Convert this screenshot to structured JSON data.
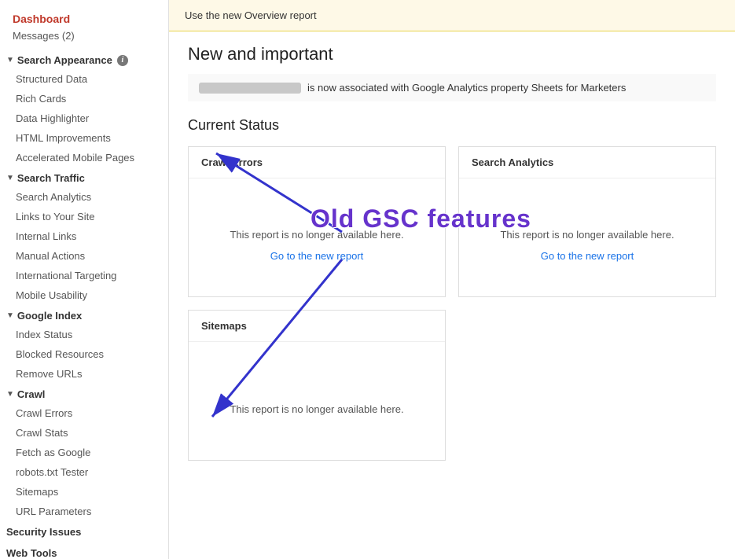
{
  "sidebar": {
    "dashboard_label": "Dashboard",
    "messages_label": "Messages (2)",
    "sections": [
      {
        "id": "search-appearance",
        "label": "Search Appearance",
        "has_info": true,
        "items": [
          "Structured Data",
          "Rich Cards",
          "Data Highlighter",
          "HTML Improvements",
          "Accelerated Mobile Pages"
        ]
      },
      {
        "id": "search-traffic",
        "label": "Search Traffic",
        "has_info": false,
        "items": [
          "Search Analytics",
          "Links to Your Site",
          "Internal Links",
          "Manual Actions",
          "International Targeting",
          "Mobile Usability"
        ]
      },
      {
        "id": "google-index",
        "label": "Google Index",
        "has_info": false,
        "items": [
          "Index Status",
          "Blocked Resources",
          "Remove URLs"
        ]
      },
      {
        "id": "crawl",
        "label": "Crawl",
        "has_info": false,
        "items": [
          "Crawl Errors",
          "Crawl Stats",
          "Fetch as Google",
          "robots.txt Tester",
          "Sitemaps",
          "URL Parameters"
        ]
      }
    ],
    "bottom_items": [
      "Security Issues",
      "Web Tools"
    ]
  },
  "main": {
    "banner_text": "Use the new Overview report",
    "new_important_title": "New and important",
    "notice_text": "is now associated with Google Analytics property Sheets for Marketers",
    "current_status_title": "Current Status",
    "cards": [
      {
        "id": "crawl-errors",
        "header": "Crawl Errors",
        "no_data_text": "This report is no longer available here.",
        "link_text": "Go to the new report"
      },
      {
        "id": "search-analytics",
        "header": "Search Analytics",
        "no_data_text": "This report is no longer available here.",
        "link_text": "Go to the new report"
      },
      {
        "id": "sitemaps",
        "header": "Sitemaps",
        "no_data_text": "This report is no longer available here.",
        "link_text": null
      }
    ],
    "annotation": "Old GSC features"
  }
}
